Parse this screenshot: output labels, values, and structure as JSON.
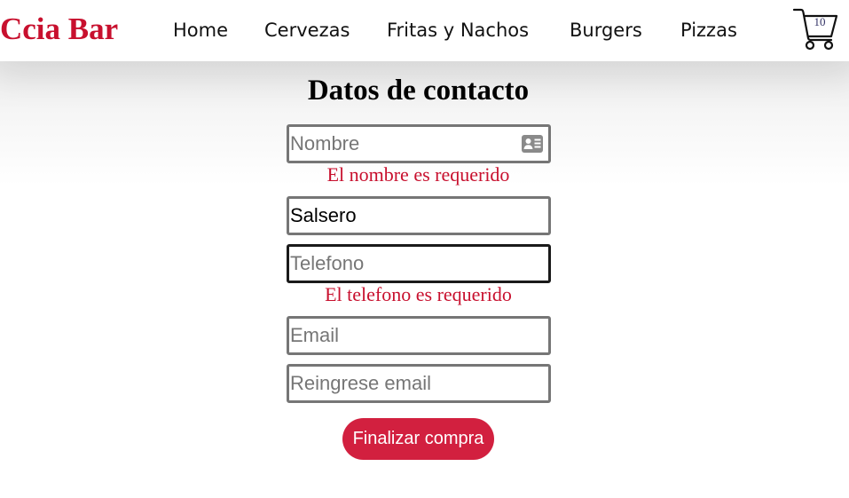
{
  "navbar": {
    "brand": "Ccia Bar",
    "links": [
      "Home",
      "Cervezas",
      "Fritas y Nachos",
      "Burgers",
      "Pizzas"
    ],
    "cart_count": "10",
    "cart_icon": "shopping-cart-icon"
  },
  "form": {
    "title": "Datos de contacto",
    "nombre": {
      "value": "",
      "placeholder": "Nombre",
      "icon": "id-card-icon",
      "error": "El nombre es requerido"
    },
    "apellido": {
      "value": "Salsero",
      "placeholder": ""
    },
    "telefono": {
      "value": "",
      "placeholder": "Telefono",
      "error": "El telefono es requerido"
    },
    "email": {
      "value": "",
      "placeholder": "Email"
    },
    "email_confirm": {
      "value": "",
      "placeholder": "Reingrese email"
    },
    "submit_label": "Finalizar compra"
  },
  "colors": {
    "brand": "#c8102e",
    "error": "#c8102e",
    "button": "#d2203f",
    "button_text": "#ffffff"
  }
}
